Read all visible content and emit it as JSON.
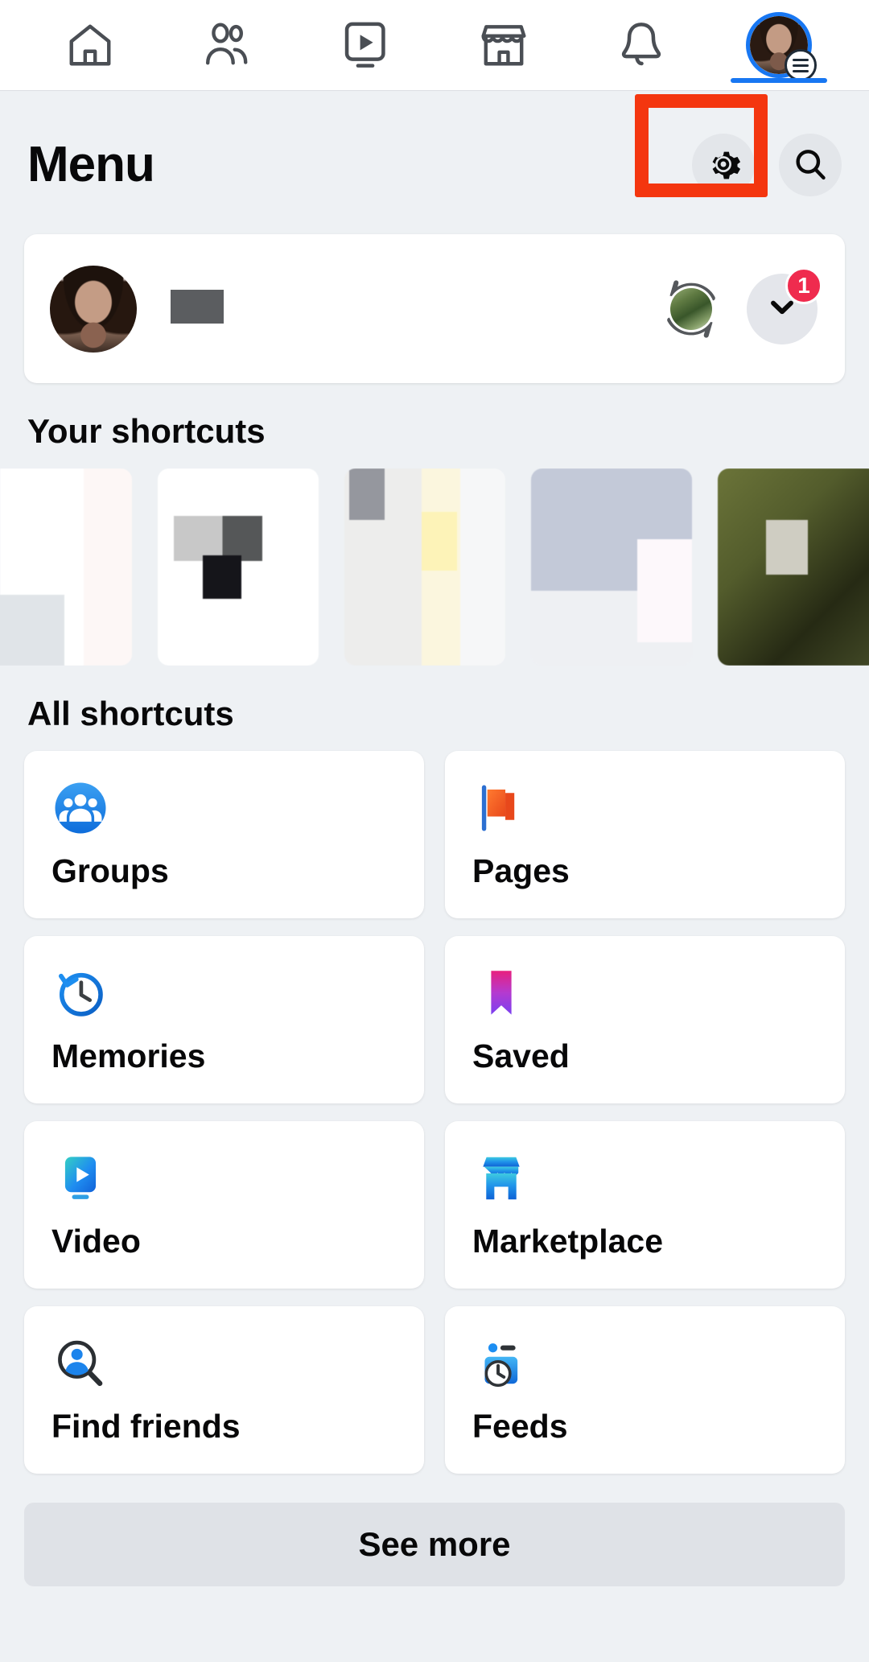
{
  "topnav": {
    "items": [
      {
        "name": "home",
        "label": "Home"
      },
      {
        "name": "friends",
        "label": "Friends"
      },
      {
        "name": "video",
        "label": "Video"
      },
      {
        "name": "marketplace",
        "label": "Marketplace"
      },
      {
        "name": "notifications",
        "label": "Notifications"
      },
      {
        "name": "menu-profile",
        "label": "Menu"
      }
    ],
    "active": "menu-profile"
  },
  "header": {
    "title": "Menu",
    "settings_icon": "gear-icon",
    "search_icon": "search-icon"
  },
  "annotation": {
    "type": "highlight-box",
    "target": "settings-button",
    "color": "#f4360f"
  },
  "profile_card": {
    "name": "",
    "name_redacted": true,
    "switch_icon": "switch-profile-icon",
    "expand_icon": "chevron-down-icon",
    "badge_count": "1",
    "badge_color": "#ef2b4e"
  },
  "your_shortcuts": {
    "title": "Your shortcuts",
    "thumbnails": [
      {
        "name": "shortcut-thumb-1",
        "blurred": true
      },
      {
        "name": "shortcut-thumb-2",
        "blurred": true
      },
      {
        "name": "shortcut-thumb-3",
        "blurred": true
      },
      {
        "name": "shortcut-thumb-4",
        "blurred": true
      },
      {
        "name": "shortcut-thumb-5",
        "blurred": true
      }
    ]
  },
  "all_shortcuts": {
    "title": "All shortcuts",
    "items": [
      {
        "label": "Groups",
        "icon": "groups-icon"
      },
      {
        "label": "Pages",
        "icon": "pages-flag-icon"
      },
      {
        "label": "Memories",
        "icon": "memories-clock-icon"
      },
      {
        "label": "Saved",
        "icon": "saved-bookmark-icon"
      },
      {
        "label": "Video",
        "icon": "video-play-icon"
      },
      {
        "label": "Marketplace",
        "icon": "marketplace-storefront-icon"
      },
      {
        "label": "Find friends",
        "icon": "find-friends-icon"
      },
      {
        "label": "Feeds",
        "icon": "feeds-icon"
      }
    ],
    "see_more_label": "See more"
  },
  "colors": {
    "brand_blue": "#1877f2",
    "background": "#eef1f4",
    "card": "#ffffff",
    "annotation_red": "#f4360f",
    "badge_red": "#ef2b4e"
  }
}
